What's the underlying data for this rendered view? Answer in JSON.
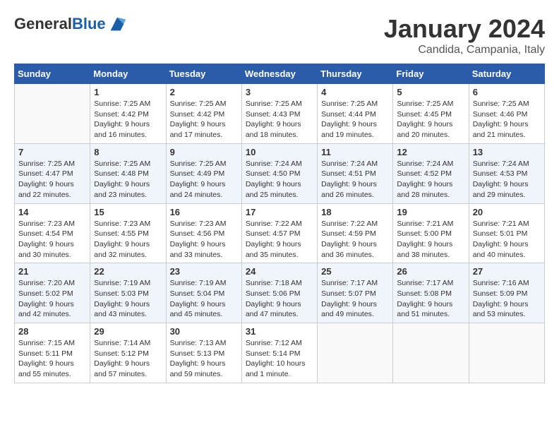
{
  "header": {
    "logo_general": "General",
    "logo_blue": "Blue",
    "month": "January 2024",
    "location": "Candida, Campania, Italy"
  },
  "days_of_week": [
    "Sunday",
    "Monday",
    "Tuesday",
    "Wednesday",
    "Thursday",
    "Friday",
    "Saturday"
  ],
  "weeks": [
    [
      {
        "day": "",
        "info": ""
      },
      {
        "day": "1",
        "info": "Sunrise: 7:25 AM\nSunset: 4:42 PM\nDaylight: 9 hours\nand 16 minutes."
      },
      {
        "day": "2",
        "info": "Sunrise: 7:25 AM\nSunset: 4:42 PM\nDaylight: 9 hours\nand 17 minutes."
      },
      {
        "day": "3",
        "info": "Sunrise: 7:25 AM\nSunset: 4:43 PM\nDaylight: 9 hours\nand 18 minutes."
      },
      {
        "day": "4",
        "info": "Sunrise: 7:25 AM\nSunset: 4:44 PM\nDaylight: 9 hours\nand 19 minutes."
      },
      {
        "day": "5",
        "info": "Sunrise: 7:25 AM\nSunset: 4:45 PM\nDaylight: 9 hours\nand 20 minutes."
      },
      {
        "day": "6",
        "info": "Sunrise: 7:25 AM\nSunset: 4:46 PM\nDaylight: 9 hours\nand 21 minutes."
      }
    ],
    [
      {
        "day": "7",
        "info": "Sunrise: 7:25 AM\nSunset: 4:47 PM\nDaylight: 9 hours\nand 22 minutes."
      },
      {
        "day": "8",
        "info": "Sunrise: 7:25 AM\nSunset: 4:48 PM\nDaylight: 9 hours\nand 23 minutes."
      },
      {
        "day": "9",
        "info": "Sunrise: 7:25 AM\nSunset: 4:49 PM\nDaylight: 9 hours\nand 24 minutes."
      },
      {
        "day": "10",
        "info": "Sunrise: 7:24 AM\nSunset: 4:50 PM\nDaylight: 9 hours\nand 25 minutes."
      },
      {
        "day": "11",
        "info": "Sunrise: 7:24 AM\nSunset: 4:51 PM\nDaylight: 9 hours\nand 26 minutes."
      },
      {
        "day": "12",
        "info": "Sunrise: 7:24 AM\nSunset: 4:52 PM\nDaylight: 9 hours\nand 28 minutes."
      },
      {
        "day": "13",
        "info": "Sunrise: 7:24 AM\nSunset: 4:53 PM\nDaylight: 9 hours\nand 29 minutes."
      }
    ],
    [
      {
        "day": "14",
        "info": "Sunrise: 7:23 AM\nSunset: 4:54 PM\nDaylight: 9 hours\nand 30 minutes."
      },
      {
        "day": "15",
        "info": "Sunrise: 7:23 AM\nSunset: 4:55 PM\nDaylight: 9 hours\nand 32 minutes."
      },
      {
        "day": "16",
        "info": "Sunrise: 7:23 AM\nSunset: 4:56 PM\nDaylight: 9 hours\nand 33 minutes."
      },
      {
        "day": "17",
        "info": "Sunrise: 7:22 AM\nSunset: 4:57 PM\nDaylight: 9 hours\nand 35 minutes."
      },
      {
        "day": "18",
        "info": "Sunrise: 7:22 AM\nSunset: 4:59 PM\nDaylight: 9 hours\nand 36 minutes."
      },
      {
        "day": "19",
        "info": "Sunrise: 7:21 AM\nSunset: 5:00 PM\nDaylight: 9 hours\nand 38 minutes."
      },
      {
        "day": "20",
        "info": "Sunrise: 7:21 AM\nSunset: 5:01 PM\nDaylight: 9 hours\nand 40 minutes."
      }
    ],
    [
      {
        "day": "21",
        "info": "Sunrise: 7:20 AM\nSunset: 5:02 PM\nDaylight: 9 hours\nand 42 minutes."
      },
      {
        "day": "22",
        "info": "Sunrise: 7:19 AM\nSunset: 5:03 PM\nDaylight: 9 hours\nand 43 minutes."
      },
      {
        "day": "23",
        "info": "Sunrise: 7:19 AM\nSunset: 5:04 PM\nDaylight: 9 hours\nand 45 minutes."
      },
      {
        "day": "24",
        "info": "Sunrise: 7:18 AM\nSunset: 5:06 PM\nDaylight: 9 hours\nand 47 minutes."
      },
      {
        "day": "25",
        "info": "Sunrise: 7:17 AM\nSunset: 5:07 PM\nDaylight: 9 hours\nand 49 minutes."
      },
      {
        "day": "26",
        "info": "Sunrise: 7:17 AM\nSunset: 5:08 PM\nDaylight: 9 hours\nand 51 minutes."
      },
      {
        "day": "27",
        "info": "Sunrise: 7:16 AM\nSunset: 5:09 PM\nDaylight: 9 hours\nand 53 minutes."
      }
    ],
    [
      {
        "day": "28",
        "info": "Sunrise: 7:15 AM\nSunset: 5:11 PM\nDaylight: 9 hours\nand 55 minutes."
      },
      {
        "day": "29",
        "info": "Sunrise: 7:14 AM\nSunset: 5:12 PM\nDaylight: 9 hours\nand 57 minutes."
      },
      {
        "day": "30",
        "info": "Sunrise: 7:13 AM\nSunset: 5:13 PM\nDaylight: 9 hours\nand 59 minutes."
      },
      {
        "day": "31",
        "info": "Sunrise: 7:12 AM\nSunset: 5:14 PM\nDaylight: 10 hours\nand 1 minute."
      },
      {
        "day": "",
        "info": ""
      },
      {
        "day": "",
        "info": ""
      },
      {
        "day": "",
        "info": ""
      }
    ]
  ]
}
